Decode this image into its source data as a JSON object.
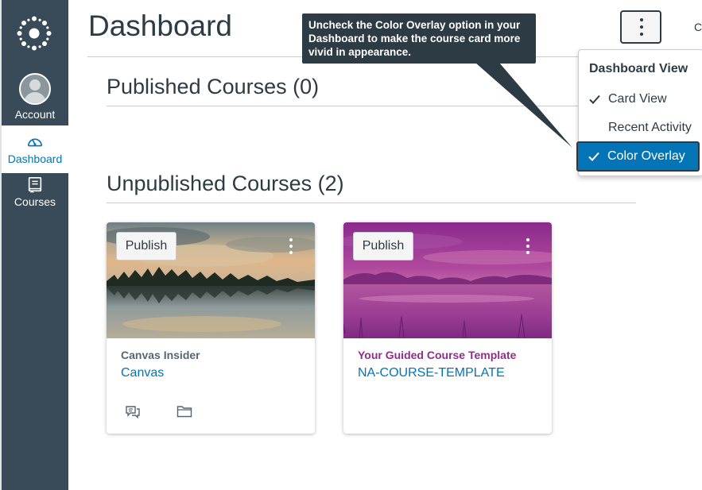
{
  "nav": {
    "account_label": "Account",
    "dashboard_label": "Dashboard",
    "courses_label": "Courses"
  },
  "header": {
    "title": "Dashboard",
    "right_cut_text": "C"
  },
  "sections": {
    "published_title": "Published Courses (0)",
    "unpublished_title": "Unpublished Courses (2)"
  },
  "cards": [
    {
      "publish_label": "Publish",
      "subtitle": "Canvas Insider",
      "code": "Canvas",
      "subtitle_color": "#556572",
      "icons": [
        "announcements-icon",
        "files-icon"
      ]
    },
    {
      "publish_label": "Publish",
      "subtitle": "Your Guided Course Template",
      "code": "NA-COURSE-TEMPLATE",
      "subtitle_color": "#902c8e",
      "icons": []
    }
  ],
  "menu": {
    "header": "Dashboard View",
    "items": [
      {
        "label": "Card View",
        "checked": true
      },
      {
        "label": "Recent Activity",
        "checked": false
      },
      {
        "label": "Color Overlay",
        "checked": true,
        "highlighted": true
      }
    ]
  },
  "tooltip": {
    "text": "Uncheck the Color Overlay option in your Dashboard to make the course card more vivid in appearance."
  },
  "colors": {
    "nav_bg": "#394b58",
    "link": "#0374b5",
    "text": "#2d3b45",
    "tooltip_bg": "#2d3b45"
  }
}
